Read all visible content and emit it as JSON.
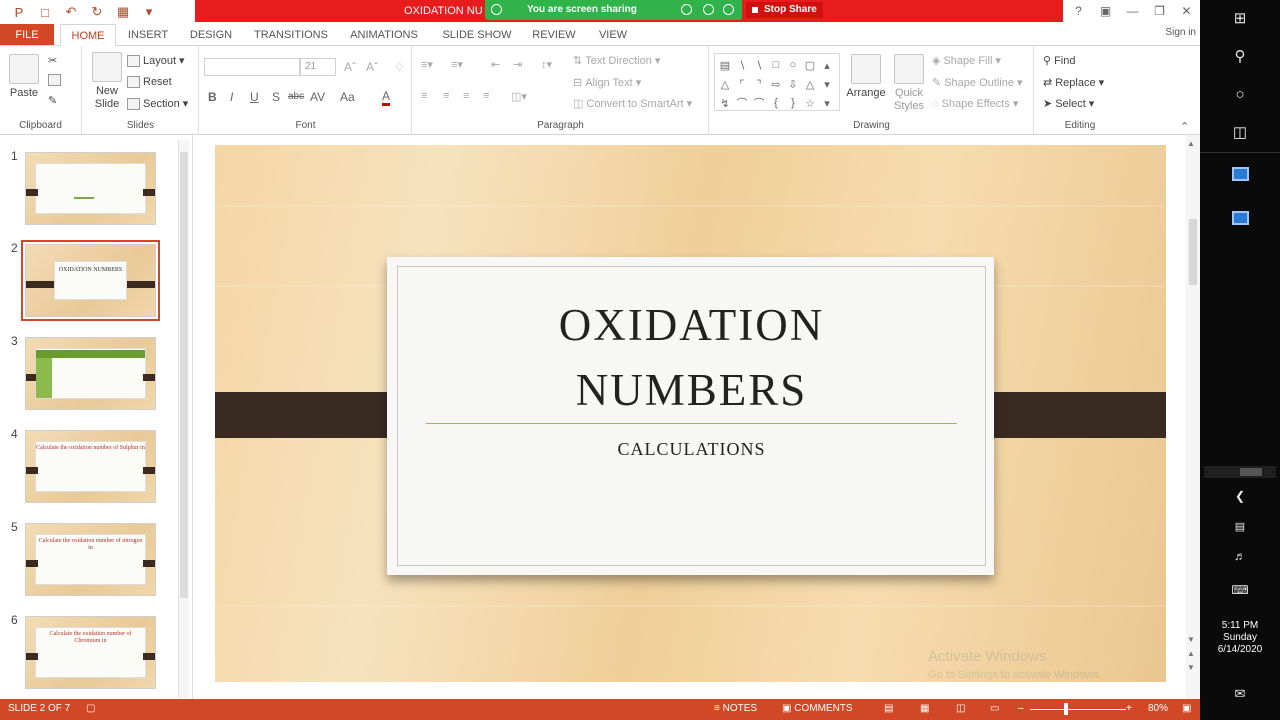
{
  "window": {
    "doc_title": "OXIDATION NU",
    "share_banner": "You are screen sharing",
    "stop_share": "Stop Share",
    "help": "?",
    "sign_in": "Sign in"
  },
  "tabs": {
    "file": "FILE",
    "items": [
      "HOME",
      "INSERT",
      "DESIGN",
      "TRANSITIONS",
      "ANIMATIONS",
      "SLIDE SHOW",
      "REVIEW",
      "VIEW"
    ],
    "active": "HOME"
  },
  "ribbon": {
    "clipboard": {
      "label": "Clipboard",
      "paste": "Paste"
    },
    "slides": {
      "label": "Slides",
      "new_slide_1": "New",
      "new_slide_2": "Slide",
      "layout": "Layout",
      "reset": "Reset",
      "section": "Section"
    },
    "font": {
      "label": "Font",
      "size": "21",
      "bold": "B",
      "italic": "I",
      "underline": "U",
      "shadow": "S",
      "strike": "abc",
      "spacing": "AV",
      "case": "Aa",
      "color": "A"
    },
    "paragraph": {
      "label": "Paragraph",
      "text_direction": "Text Direction",
      "align_text": "Align Text",
      "convert_smartart": "Convert to SmartArt"
    },
    "drawing": {
      "label": "Drawing",
      "arrange": "Arrange",
      "quick_styles_1": "Quick",
      "quick_styles_2": "Styles",
      "shape_fill": "Shape Fill",
      "shape_outline": "Shape Outline",
      "shape_effects": "Shape Effects"
    },
    "editing": {
      "label": "Editing",
      "find": "Find",
      "replace": "Replace",
      "select": "Select"
    }
  },
  "thumbnails": [
    {
      "num": "1",
      "text": ""
    },
    {
      "num": "2",
      "text": "OXIDATION NUMBERS"
    },
    {
      "num": "3",
      "text": ""
    },
    {
      "num": "4",
      "text": "Calculate the oxidation number of Sulphur in"
    },
    {
      "num": "5",
      "text": "Calculate the oxidation number of nitrogen in"
    },
    {
      "num": "6",
      "text": "Calculate the oxidation number of Chromium in"
    }
  ],
  "slide": {
    "title_line1": "OXIDATION",
    "title_line2": "NUMBERS",
    "subtitle": "CALCULATIONS"
  },
  "watermark": {
    "line1": "Activate Windows",
    "line2": "Go to Settings to activate Windows."
  },
  "status": {
    "slide_of": "SLIDE 2 OF 7",
    "notes": "NOTES",
    "comments": "COMMENTS",
    "zoom": "80%"
  },
  "clock": {
    "time": "5:11 PM",
    "day": "Sunday",
    "date": "6/14/2020"
  },
  "colors": {
    "accent": "#d24726",
    "share_green": "#2fb34a",
    "title_red": "#e81c1c",
    "band": "#3a2b22"
  }
}
